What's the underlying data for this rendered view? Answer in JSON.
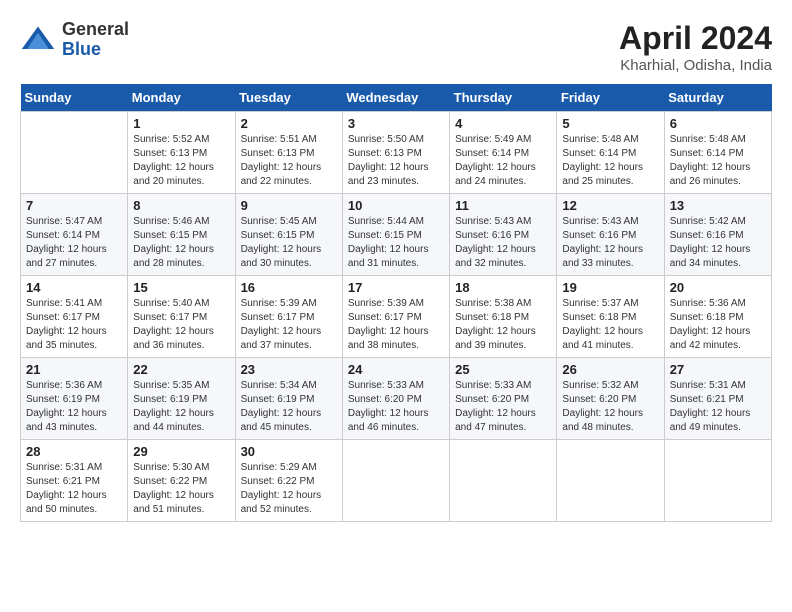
{
  "header": {
    "logo_general": "General",
    "logo_blue": "Blue",
    "month": "April 2024",
    "location": "Kharhial, Odisha, India"
  },
  "calendar": {
    "days_of_week": [
      "Sunday",
      "Monday",
      "Tuesday",
      "Wednesday",
      "Thursday",
      "Friday",
      "Saturday"
    ],
    "weeks": [
      [
        {
          "day": "",
          "sunrise": "",
          "sunset": "",
          "daylight": ""
        },
        {
          "day": "1",
          "sunrise": "Sunrise: 5:52 AM",
          "sunset": "Sunset: 6:13 PM",
          "daylight": "Daylight: 12 hours and 20 minutes."
        },
        {
          "day": "2",
          "sunrise": "Sunrise: 5:51 AM",
          "sunset": "Sunset: 6:13 PM",
          "daylight": "Daylight: 12 hours and 22 minutes."
        },
        {
          "day": "3",
          "sunrise": "Sunrise: 5:50 AM",
          "sunset": "Sunset: 6:13 PM",
          "daylight": "Daylight: 12 hours and 23 minutes."
        },
        {
          "day": "4",
          "sunrise": "Sunrise: 5:49 AM",
          "sunset": "Sunset: 6:14 PM",
          "daylight": "Daylight: 12 hours and 24 minutes."
        },
        {
          "day": "5",
          "sunrise": "Sunrise: 5:48 AM",
          "sunset": "Sunset: 6:14 PM",
          "daylight": "Daylight: 12 hours and 25 minutes."
        },
        {
          "day": "6",
          "sunrise": "Sunrise: 5:48 AM",
          "sunset": "Sunset: 6:14 PM",
          "daylight": "Daylight: 12 hours and 26 minutes."
        }
      ],
      [
        {
          "day": "7",
          "sunrise": "Sunrise: 5:47 AM",
          "sunset": "Sunset: 6:14 PM",
          "daylight": "Daylight: 12 hours and 27 minutes."
        },
        {
          "day": "8",
          "sunrise": "Sunrise: 5:46 AM",
          "sunset": "Sunset: 6:15 PM",
          "daylight": "Daylight: 12 hours and 28 minutes."
        },
        {
          "day": "9",
          "sunrise": "Sunrise: 5:45 AM",
          "sunset": "Sunset: 6:15 PM",
          "daylight": "Daylight: 12 hours and 30 minutes."
        },
        {
          "day": "10",
          "sunrise": "Sunrise: 5:44 AM",
          "sunset": "Sunset: 6:15 PM",
          "daylight": "Daylight: 12 hours and 31 minutes."
        },
        {
          "day": "11",
          "sunrise": "Sunrise: 5:43 AM",
          "sunset": "Sunset: 6:16 PM",
          "daylight": "Daylight: 12 hours and 32 minutes."
        },
        {
          "day": "12",
          "sunrise": "Sunrise: 5:43 AM",
          "sunset": "Sunset: 6:16 PM",
          "daylight": "Daylight: 12 hours and 33 minutes."
        },
        {
          "day": "13",
          "sunrise": "Sunrise: 5:42 AM",
          "sunset": "Sunset: 6:16 PM",
          "daylight": "Daylight: 12 hours and 34 minutes."
        }
      ],
      [
        {
          "day": "14",
          "sunrise": "Sunrise: 5:41 AM",
          "sunset": "Sunset: 6:17 PM",
          "daylight": "Daylight: 12 hours and 35 minutes."
        },
        {
          "day": "15",
          "sunrise": "Sunrise: 5:40 AM",
          "sunset": "Sunset: 6:17 PM",
          "daylight": "Daylight: 12 hours and 36 minutes."
        },
        {
          "day": "16",
          "sunrise": "Sunrise: 5:39 AM",
          "sunset": "Sunset: 6:17 PM",
          "daylight": "Daylight: 12 hours and 37 minutes."
        },
        {
          "day": "17",
          "sunrise": "Sunrise: 5:39 AM",
          "sunset": "Sunset: 6:17 PM",
          "daylight": "Daylight: 12 hours and 38 minutes."
        },
        {
          "day": "18",
          "sunrise": "Sunrise: 5:38 AM",
          "sunset": "Sunset: 6:18 PM",
          "daylight": "Daylight: 12 hours and 39 minutes."
        },
        {
          "day": "19",
          "sunrise": "Sunrise: 5:37 AM",
          "sunset": "Sunset: 6:18 PM",
          "daylight": "Daylight: 12 hours and 41 minutes."
        },
        {
          "day": "20",
          "sunrise": "Sunrise: 5:36 AM",
          "sunset": "Sunset: 6:18 PM",
          "daylight": "Daylight: 12 hours and 42 minutes."
        }
      ],
      [
        {
          "day": "21",
          "sunrise": "Sunrise: 5:36 AM",
          "sunset": "Sunset: 6:19 PM",
          "daylight": "Daylight: 12 hours and 43 minutes."
        },
        {
          "day": "22",
          "sunrise": "Sunrise: 5:35 AM",
          "sunset": "Sunset: 6:19 PM",
          "daylight": "Daylight: 12 hours and 44 minutes."
        },
        {
          "day": "23",
          "sunrise": "Sunrise: 5:34 AM",
          "sunset": "Sunset: 6:19 PM",
          "daylight": "Daylight: 12 hours and 45 minutes."
        },
        {
          "day": "24",
          "sunrise": "Sunrise: 5:33 AM",
          "sunset": "Sunset: 6:20 PM",
          "daylight": "Daylight: 12 hours and 46 minutes."
        },
        {
          "day": "25",
          "sunrise": "Sunrise: 5:33 AM",
          "sunset": "Sunset: 6:20 PM",
          "daylight": "Daylight: 12 hours and 47 minutes."
        },
        {
          "day": "26",
          "sunrise": "Sunrise: 5:32 AM",
          "sunset": "Sunset: 6:20 PM",
          "daylight": "Daylight: 12 hours and 48 minutes."
        },
        {
          "day": "27",
          "sunrise": "Sunrise: 5:31 AM",
          "sunset": "Sunset: 6:21 PM",
          "daylight": "Daylight: 12 hours and 49 minutes."
        }
      ],
      [
        {
          "day": "28",
          "sunrise": "Sunrise: 5:31 AM",
          "sunset": "Sunset: 6:21 PM",
          "daylight": "Daylight: 12 hours and 50 minutes."
        },
        {
          "day": "29",
          "sunrise": "Sunrise: 5:30 AM",
          "sunset": "Sunset: 6:22 PM",
          "daylight": "Daylight: 12 hours and 51 minutes."
        },
        {
          "day": "30",
          "sunrise": "Sunrise: 5:29 AM",
          "sunset": "Sunset: 6:22 PM",
          "daylight": "Daylight: 12 hours and 52 minutes."
        },
        {
          "day": "",
          "sunrise": "",
          "sunset": "",
          "daylight": ""
        },
        {
          "day": "",
          "sunrise": "",
          "sunset": "",
          "daylight": ""
        },
        {
          "day": "",
          "sunrise": "",
          "sunset": "",
          "daylight": ""
        },
        {
          "day": "",
          "sunrise": "",
          "sunset": "",
          "daylight": ""
        }
      ]
    ]
  }
}
